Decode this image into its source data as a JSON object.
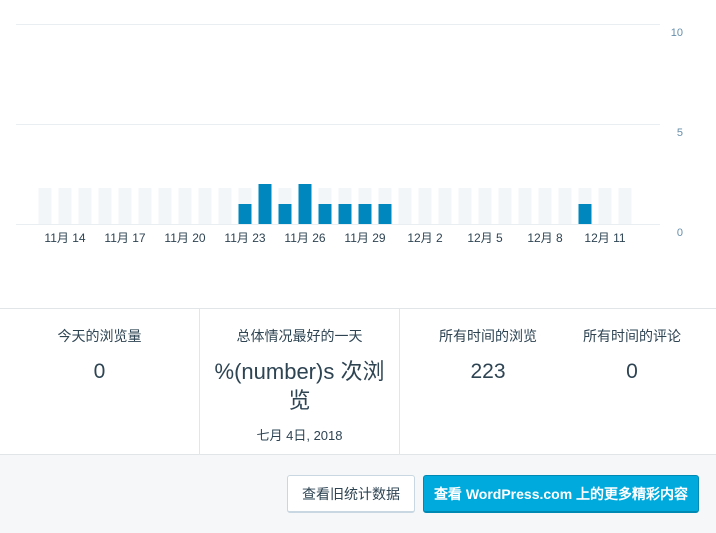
{
  "chart_data": {
    "type": "bar",
    "y_ticks": [
      "10",
      "5",
      "0"
    ],
    "ylim": [
      0,
      10
    ],
    "x_tick_labels": [
      "11月 14",
      "11月 17",
      "11月 20",
      "11月 23",
      "11月 26",
      "11月 29",
      "12月 2",
      "12月 5",
      "12月 8",
      "12月 11"
    ],
    "values": [
      0,
      0,
      0,
      0,
      0,
      0,
      0,
      0,
      0,
      0,
      1,
      2,
      1,
      2,
      1,
      1,
      1,
      1,
      0,
      0,
      0,
      0,
      0,
      0,
      0,
      0,
      0,
      1,
      0,
      0
    ],
    "grid": true,
    "colors": {
      "bar": "#0087be",
      "empty_bar": "#f3f6f8",
      "grid": "#e9eef2",
      "tick": "#668eaa"
    }
  },
  "stats": {
    "today_label": "今天的浏览量",
    "today_value": "0",
    "best_day_label": "总体情况最好的一天",
    "best_day_value_line1": "%(number)s 次浏",
    "best_day_value_line2": "览",
    "best_day_date": "七月 4日, 2018",
    "all_time_views_label": "所有时间的浏览",
    "all_time_views_value": "223",
    "all_time_comments_label": "所有时间的评论",
    "all_time_comments_value": "0"
  },
  "footer": {
    "old_stats_button": "查看旧统计数据",
    "wpcom_button": "查看 WordPress.com 上的更多精彩内容"
  }
}
